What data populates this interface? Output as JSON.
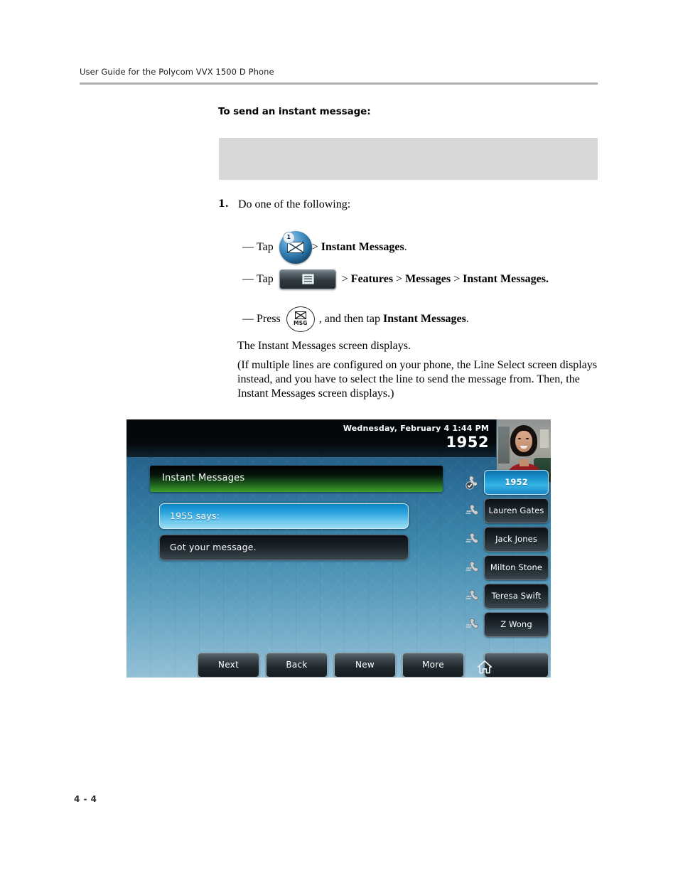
{
  "header": {
    "running_head": "User Guide for the Polycom VVX 1500 D Phone"
  },
  "section": {
    "heading": "To send an instant message:"
  },
  "note_box": {
    "content": ""
  },
  "step": {
    "number": "1.",
    "text": "Do one of the following:",
    "bullets": [
      {
        "dash": "—",
        "lead": "Tap",
        "icon": "mail-circle-icon",
        "badge": "1",
        "trailing_plain": "> ",
        "trailing_bold": "Instant Messages",
        "trailing_end": "."
      },
      {
        "dash": "—",
        "lead": "Tap",
        "icon": "menu-hardkey-icon",
        "trailing_plain": "> ",
        "trailing_bold": "Features",
        "sep1": " > ",
        "trailing_bold2": "Messages",
        "sep2": " > ",
        "trailing_bold3": "Instant Messages."
      },
      {
        "dash": "—",
        "lead": "Press",
        "icon": "msg-hardkey-icon",
        "icon_label": "MSG",
        "trailing_plain": ", and then tap ",
        "trailing_bold": "Instant Messages",
        "trailing_end": "."
      }
    ]
  },
  "paragraphs": {
    "result": "The Instant Messages screen displays.",
    "note": "(If multiple lines are configured on your phone, the Line Select screen displays instead, and you have to select the line to send the message from. Then, the Instant Messages screen displays.)"
  },
  "phone_screen": {
    "statusbar": {
      "datetime": "Wednesday, February 4  1:44 PM",
      "extension": "1952"
    },
    "video_thumbnail": {
      "alt": "near-site-video-thumbnail"
    },
    "title_bar": {
      "label": "Instant Messages"
    },
    "messages": [
      {
        "text": "1955 says:",
        "selected": true
      },
      {
        "text": "Got your message.",
        "selected": false
      }
    ],
    "line_keys": [
      {
        "label": "1952",
        "active": true
      },
      {
        "label": "Lauren Gates",
        "active": false
      },
      {
        "label": "Jack Jones",
        "active": false
      },
      {
        "label": "Milton Stone",
        "active": false
      },
      {
        "label": "Teresa Swift",
        "active": false
      },
      {
        "label": "Z Wong",
        "active": false
      }
    ],
    "soft_keys": [
      {
        "label": "Next"
      },
      {
        "label": "Back"
      },
      {
        "label": "New"
      },
      {
        "label": "More"
      },
      {
        "label": "",
        "icon": "home-icon"
      }
    ],
    "colors": {
      "selected_message": "#36b4e6",
      "title_bar_green": "#3e9d2c",
      "screen_blue": "#3d88ad"
    }
  },
  "footer": {
    "page_number": "4 - 4"
  }
}
